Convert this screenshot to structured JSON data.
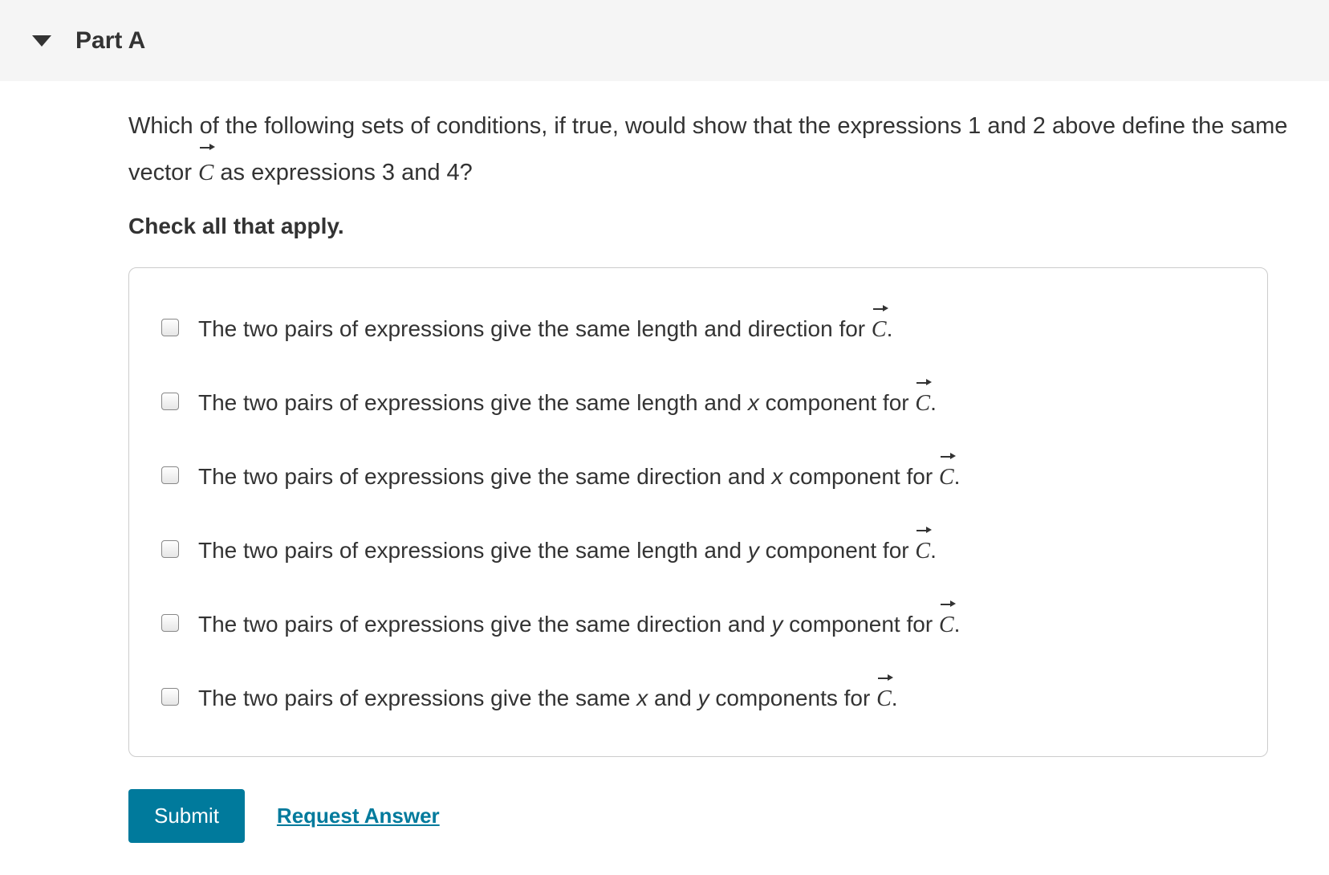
{
  "header": {
    "part_label": "Part A"
  },
  "question": {
    "line1_before": "Which of the following sets of conditions, if true, would show that the expressions 1 and 2 above define the same vector ",
    "vector_symbol": "C",
    "line1_after": " as expressions 3 and 4?",
    "instruction": "Check all that apply."
  },
  "options": [
    {
      "before": "The two pairs of expressions give the same length and direction for ",
      "vec": "C",
      "after": "."
    },
    {
      "before": "The two pairs of expressions give the same length and ",
      "var1": "x",
      "mid": " component for ",
      "vec": "C",
      "after": "."
    },
    {
      "before": "The two pairs of expressions give the same direction and ",
      "var1": "x",
      "mid": " component for ",
      "vec": "C",
      "after": "."
    },
    {
      "before": "The two pairs of expressions give the same length and ",
      "var1": "y",
      "mid": " component for ",
      "vec": "C",
      "after": "."
    },
    {
      "before": "The two pairs of expressions give the same direction and ",
      "var1": "y",
      "mid": " component for ",
      "vec": "C",
      "after": "."
    },
    {
      "before": "The two pairs of expressions give the same ",
      "var1": "x",
      "mid": " and ",
      "var2": "y",
      "mid2": " components for ",
      "vec": "C",
      "after": "."
    }
  ],
  "actions": {
    "submit_label": "Submit",
    "request_label": "Request Answer"
  }
}
